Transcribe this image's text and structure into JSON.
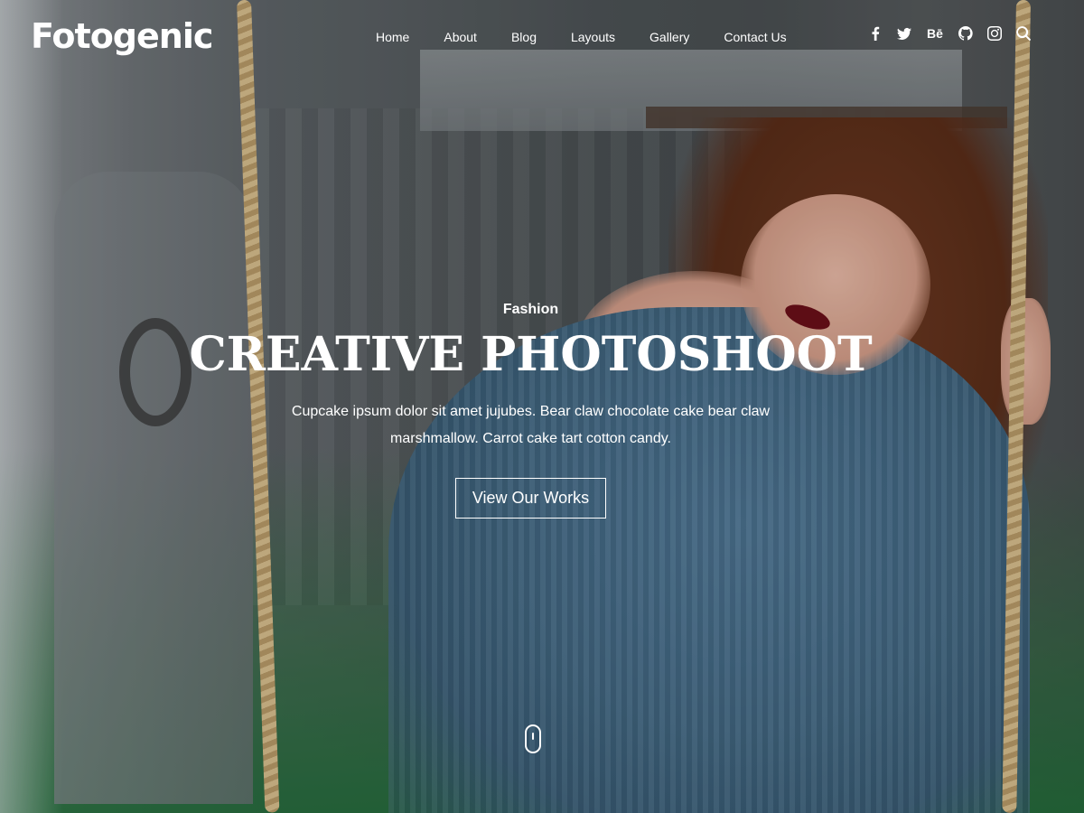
{
  "site": {
    "logo": "Fotogenic"
  },
  "nav": {
    "items": [
      {
        "label": "Home"
      },
      {
        "label": "About"
      },
      {
        "label": "Blog"
      },
      {
        "label": "Layouts"
      },
      {
        "label": "Gallery"
      },
      {
        "label": "Contact Us"
      }
    ]
  },
  "social": {
    "icons": [
      "facebook-icon",
      "twitter-icon",
      "behance-icon",
      "github-icon",
      "instagram-icon",
      "search-icon"
    ],
    "behance_glyph": "Bē"
  },
  "hero": {
    "kicker": "Fashion",
    "title": "CREATIVE PHOTOSHOOT",
    "description": "Cupcake ipsum dolor sit amet jujubes. Bear claw chocolate cake bear claw marshmallow. Carrot cake tart cotton candy.",
    "cta_label": "View Our Works"
  },
  "colors": {
    "text": "#ffffff",
    "bottom_tint": "#1e6e37"
  }
}
